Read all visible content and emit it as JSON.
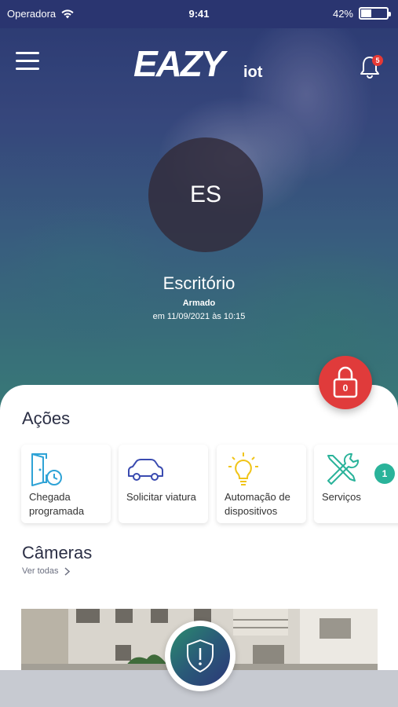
{
  "statusbar": {
    "carrier": "Operadora",
    "time": "9:41",
    "battery": "42%",
    "battery_level": 0.42
  },
  "header": {
    "logo_main": "EAZY",
    "logo_sub": "iot",
    "notification_count": "5"
  },
  "profile": {
    "initials": "ES",
    "name": "Escritório",
    "status": "Armado",
    "date": "em 11/09/2021 às 10:15"
  },
  "lock": {
    "count": "0"
  },
  "actions": {
    "title": "Ações",
    "items": [
      {
        "label": "Chegada programada",
        "icon": "door-clock-icon"
      },
      {
        "label": "Solicitar viatura",
        "icon": "car-icon"
      },
      {
        "label": "Automação de dispositivos",
        "icon": "lightbulb-icon"
      },
      {
        "label": "Serviços",
        "icon": "tools-icon"
      }
    ],
    "badge": "1"
  },
  "cameras": {
    "title": "Câmeras",
    "see_all": "Ver todas"
  },
  "colors": {
    "header_bg": "#2a3570",
    "lock_red": "#e03b3b",
    "badge_green": "#2ab39a",
    "icon_blue": "#2fa3d6",
    "car_blue": "#3a4bb0",
    "bulb_yellow": "#f0c419",
    "tools_green": "#2ab39a"
  }
}
